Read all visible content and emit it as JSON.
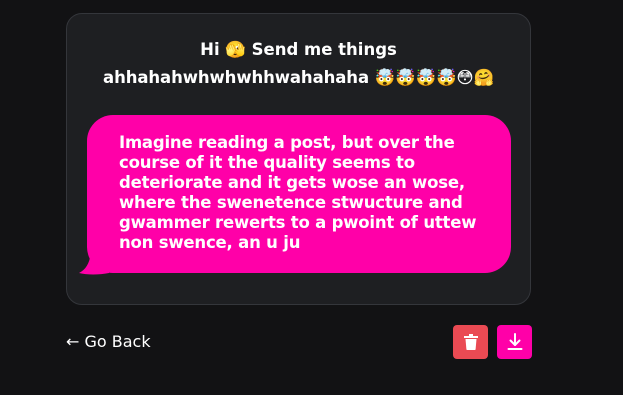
{
  "card": {
    "prompt_line1": "Hi 🫣 Send me things",
    "prompt_line2": "ahhahahwhwhwhhwahahaha 🤯🤯🤯🤯😳🤗",
    "message": "Imagine reading a post, but over the course of it the quality seems to deteriorate and it gets wose an wose, where the swenetence stwucture and gwammer rewerts to a pwoint of uttew non swence, an u ju"
  },
  "footer": {
    "go_back_label": "← Go Back"
  },
  "icons": {
    "delete": "trash-icon",
    "download": "download-icon"
  },
  "colors": {
    "background": "#121214",
    "card": "#1e1f22",
    "bubble": "#ff00a8",
    "delete_button": "#ea4a53",
    "download_button": "#ff00a8"
  }
}
